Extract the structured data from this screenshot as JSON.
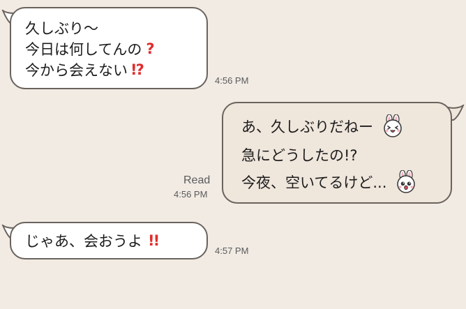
{
  "messages": [
    {
      "side": "incoming",
      "lines": [
        "久しぶり〜",
        "今日は何してんの",
        "今から会えない"
      ],
      "time": "4:56 PM"
    },
    {
      "side": "outgoing",
      "lines": [
        "あ、久しぶりだねー",
        "急にどうしたの!?",
        "今夜、空いてるけど..."
      ],
      "status": "Read",
      "time": "4:56 PM"
    },
    {
      "side": "incoming",
      "lines": [
        "じゃあ、会おうよ"
      ],
      "time": "4:57 PM"
    }
  ],
  "colors": {
    "background": "#f1ebe4",
    "incoming_bubble": "#ffffff",
    "outgoing_bubble": "#efe6dc",
    "bubble_border": "#6a625d",
    "emoji_red": "#e02d2d",
    "timestamp_text": "#5b5b5b"
  },
  "icons": {
    "question_mark": "red-question-mark-icon",
    "exclamation_question": "red-exclamation-question-icon",
    "double_exclamation": "red-double-exclamation-icon",
    "bunny_laughing": "bunny-laughing-sticker-icon",
    "bunny_surprised": "bunny-surprised-sticker-icon"
  }
}
